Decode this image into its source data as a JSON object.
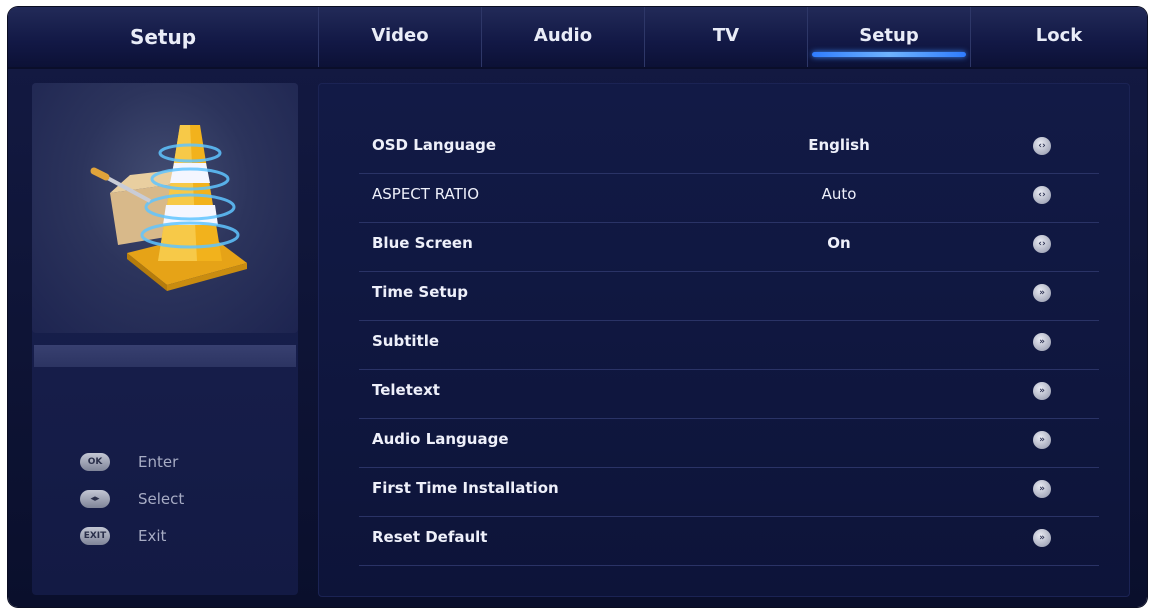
{
  "header": {
    "menu_title": "Setup",
    "tabs": [
      {
        "label": "Video"
      },
      {
        "label": "Audio"
      },
      {
        "label": "TV"
      },
      {
        "label": "Setup"
      },
      {
        "label": "Lock"
      }
    ],
    "active_tab": "Setup"
  },
  "left": {
    "hints": [
      {
        "key": "OK",
        "label": "Enter"
      },
      {
        "key": "◂▸",
        "label": "Select"
      },
      {
        "key": "EXIT",
        "label": "Exit"
      }
    ]
  },
  "settings": [
    {
      "label": "OSD Language",
      "value": "English",
      "action_icon": "left-right-arrows-icon"
    },
    {
      "label": "ASPECT RATIO",
      "value": "Auto",
      "action_icon": "left-right-arrows-icon"
    },
    {
      "label": "Blue Screen",
      "value": "On",
      "action_icon": "left-right-arrows-icon"
    },
    {
      "label": "Time Setup",
      "value": "",
      "action_icon": "submenu-arrow-icon"
    },
    {
      "label": "Subtitle",
      "value": "",
      "action_icon": "submenu-arrow-icon"
    },
    {
      "label": "Teletext",
      "value": "",
      "action_icon": "submenu-arrow-icon"
    },
    {
      "label": "Audio Language",
      "value": "",
      "action_icon": "submenu-arrow-icon"
    },
    {
      "label": "First Time Installation",
      "value": "",
      "action_icon": "submenu-arrow-icon"
    },
    {
      "label": "Reset Default",
      "value": "",
      "action_icon": "submenu-arrow-icon"
    }
  ],
  "colors": {
    "background": "#0f1538",
    "accent": "#3f8cff",
    "text": "#eef0fa"
  }
}
